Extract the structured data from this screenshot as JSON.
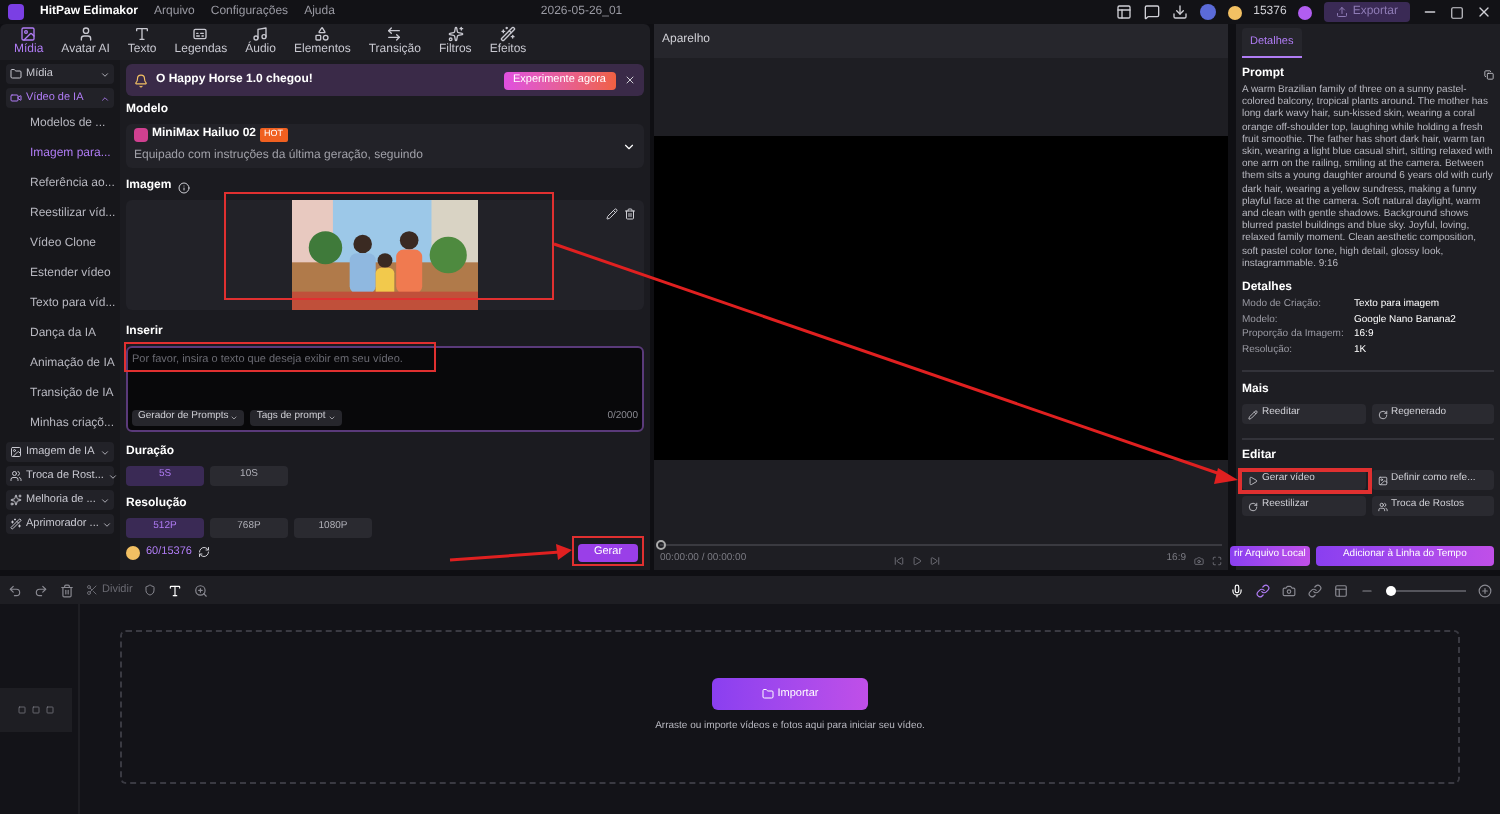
{
  "app": {
    "name": "HitPaw Edimakor",
    "menus": [
      "Arquivo",
      "Configurações",
      "Ajuda"
    ],
    "project": "2026-05-26_01",
    "coins": "15376",
    "export": "Exportar"
  },
  "tabs": [
    {
      "label": "Mídia",
      "selected": true
    },
    {
      "label": "Avatar AI",
      "selected": false
    },
    {
      "label": "Texto",
      "selected": false
    },
    {
      "label": "Legendas",
      "selected": false
    },
    {
      "label": "Áudio",
      "selected": false
    },
    {
      "label": "Elementos",
      "selected": false
    },
    {
      "label": "Transição",
      "selected": false
    },
    {
      "label": "Filtros",
      "selected": false
    },
    {
      "label": "Efeitos",
      "selected": false
    }
  ],
  "sidebar": [
    {
      "label": "Mídia",
      "expanded": false
    },
    {
      "label": "Vídeo de IA",
      "expanded": true,
      "children": [
        {
          "label": "Modelos de ...",
          "selected": false
        },
        {
          "label": "Imagem para...",
          "selected": true
        },
        {
          "label": "Referência ao...",
          "selected": false
        },
        {
          "label": "Reestilizar víd...",
          "selected": false
        },
        {
          "label": "Vídeo Clone",
          "selected": false
        },
        {
          "label": "Estender vídeo",
          "selected": false
        },
        {
          "label": "Texto para víd...",
          "selected": false
        },
        {
          "label": "Dança da IA",
          "selected": false
        },
        {
          "label": "Animação de IA",
          "selected": false
        },
        {
          "label": "Transição de IA",
          "selected": false
        },
        {
          "label": "Minhas criaçõ...",
          "selected": false
        }
      ]
    },
    {
      "label": "Imagem de IA",
      "expanded": false
    },
    {
      "label": "Troca de Rost...",
      "expanded": false
    },
    {
      "label": "Melhoria de ...",
      "expanded": false
    },
    {
      "label": "Aprimorador ...",
      "expanded": false
    }
  ],
  "banner": {
    "text": "O Happy Horse 1.0 chegou!",
    "button": "Experimente agora"
  },
  "model": {
    "heading": "Modelo",
    "name": "MiniMax Hailuo 02",
    "badge": "HOT",
    "description": "Equipado com instruções da última geração, seguindo"
  },
  "image": {
    "heading": "Imagem"
  },
  "prompt": {
    "heading": "Inserir",
    "placeholder": "Por favor, insira o texto que deseja exibir em seu vídeo.",
    "count": "0/2000",
    "tools": [
      "Gerador de Prompts",
      "Tags de prompt"
    ]
  },
  "duration": {
    "heading": "Duração",
    "options": [
      {
        "label": "5S",
        "selected": true
      },
      {
        "label": "10S",
        "selected": false
      }
    ]
  },
  "resolution": {
    "heading": "Resolução",
    "options": [
      {
        "label": "512P",
        "selected": true
      },
      {
        "label": "768P",
        "selected": false
      },
      {
        "label": "1080P",
        "selected": false
      }
    ]
  },
  "credits": "60/15376",
  "generate": "Gerar",
  "preview": {
    "title": "Aparelho",
    "playhead": {
      "level": 0
    },
    "zoom": {
      "level": 0.05
    },
    "time": "00:00:00 / 00:00:00",
    "ratio": "16:9"
  },
  "details": {
    "tab": "Detalhes",
    "prompt_heading": "Prompt",
    "prompt": "A warm Brazilian family of three on a sunny pastel-colored balcony, tropical plants around. The mother has long dark wavy hair, sun-kissed skin, wearing a coral orange off-shoulder top, laughing while holding a fresh fruit smoothie. The father has short dark hair, warm tan skin, wearing a light blue casual shirt, sitting relaxed with one arm on the railing, smiling at the camera. Between them sits a young daughter around 6 years old with curly dark hair, wearing a yellow sundress, making a funny playful face at the camera. Soft natural daylight, warm and clean with gentle shadows. Background shows blurred pastel buildings and blue sky. Joyful, loving, relaxed family moment. Clean aesthetic composition, soft pastel color tone, high detail, glossy look, instagrammable. 9:16",
    "info_heading": "Detalhes",
    "info": [
      {
        "key": "Modo de Criação:",
        "value": "Texto para imagem"
      },
      {
        "key": "Modelo:",
        "value": "Google Nano Banana2"
      },
      {
        "key": "Proporção da Imagem:",
        "value": "16:9"
      },
      {
        "key": "Resolução:",
        "value": "1K"
      }
    ],
    "more_heading": "Mais",
    "more": [
      "Reeditar",
      "Regenerado"
    ],
    "edit_heading": "Editar",
    "edit": [
      "Gerar vídeo",
      "Definir como refe...",
      "Reestilizar",
      "Troca de Rostos"
    ],
    "actions": [
      "rir Arquivo Local",
      "Adicionar à Linha do Tempo"
    ]
  },
  "timeline": {
    "split": "Dividir",
    "import": "Importar",
    "hint": "Arraste ou importe vídeos e fotos aqui para iniciar seu vídeo."
  }
}
